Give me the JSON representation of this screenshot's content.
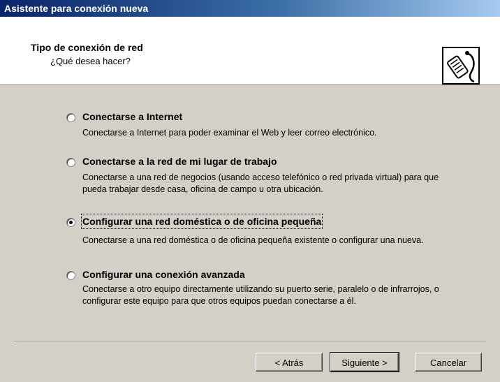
{
  "window": {
    "title": "Asistente para conexión nueva"
  },
  "header": {
    "title": "Tipo de conexión de red",
    "subtitle": "¿Qué desea hacer?",
    "icon": "phone-connection-icon"
  },
  "options": [
    {
      "label": "Conectarse a Internet",
      "description": "Conectarse a Internet para poder examinar el Web y leer correo electrónico.",
      "checked": false
    },
    {
      "label": "Conectarse a la red de mi lugar de trabajo",
      "description": "Conectarse a una red de negocios (usando acceso telefónico o red privada virtual) para que pueda trabajar desde casa, oficina de campo u otra ubicación.",
      "checked": false
    },
    {
      "label": "Configurar una red doméstica o de oficina pequeña",
      "description": "Conectarse a una red doméstica o de oficina pequeña existente o configurar una nueva.",
      "checked": true
    },
    {
      "label": "Configurar una conexión avanzada",
      "description": "Conectarse a otro equipo directamente utilizando su puerto serie, paralelo o de infrarrojos, o configurar este equipo para que otros equipos puedan conectarse a él.",
      "checked": false
    }
  ],
  "buttons": {
    "back": "< Atrás",
    "next": "Siguiente >",
    "cancel": "Cancelar"
  },
  "colors": {
    "titlebar_start": "#0a246a",
    "titlebar_end": "#a6caf0",
    "dialog_bg": "#d4d0c8"
  }
}
